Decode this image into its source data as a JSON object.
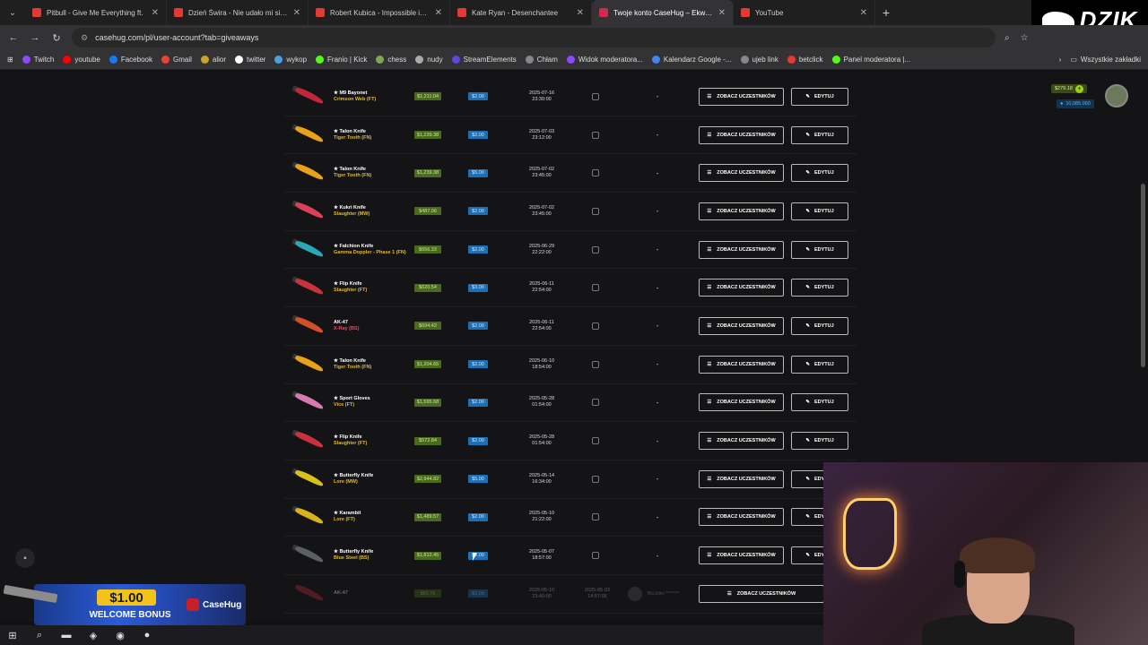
{
  "browser": {
    "tabs": [
      {
        "label": "Pitbull - Give Me Everything ft.",
        "active": false
      },
      {
        "label": "Dzień Świra - Nie udało mi się z",
        "active": false
      },
      {
        "label": "Robert Kubica - Impossible is n",
        "active": false
      },
      {
        "label": "Kate Ryan - Desenchantee",
        "active": false
      },
      {
        "label": "Twoje konto CaseHug – Ekwipu",
        "active": true
      },
      {
        "label": "YouTube",
        "active": false
      }
    ],
    "url": "casehug.com/pl/user-account?tab=giveaways",
    "bookmarks": [
      "Twitch",
      "youtube",
      "Facebook",
      "Gmail",
      "alior",
      "twitter",
      "wykop",
      "Franio | Kick",
      "chess",
      "nudy",
      "StreamElements",
      "Chłam",
      "Widok moderatora...",
      "Kalendarz Google -...",
      "ujeb link",
      "betclick",
      "Panel moderatora |..."
    ],
    "bookmarks_all": "Wszystkie zakładki"
  },
  "overlay": {
    "brand": "DZIK"
  },
  "user": {
    "balance": "$279.18",
    "coins": "10,085.060"
  },
  "buttons": {
    "view": "ZOBACZ UCZESTNIKÓW",
    "edit": "EDYTUJ"
  },
  "rows": [
    {
      "name": "★ M9 Bayonet",
      "cond": "Crimson Web (FT)",
      "price": "$1,211.04",
      "cost": "$2.00",
      "date": "2025-07-16",
      "time": "23:30:00",
      "blade": "#c0283a"
    },
    {
      "name": "★ Talon Knife",
      "cond": "Tiger Tooth (FN)",
      "price": "$1,239.38",
      "cost": "$2.00",
      "date": "2025-07-03",
      "time": "23:12:00",
      "blade": "#e8a21a"
    },
    {
      "name": "★ Talon Knife",
      "cond": "Tiger Tooth (FN)",
      "price": "$1,239.38",
      "cost": "$5.00",
      "date": "2025-07-02",
      "time": "23:45:00",
      "blade": "#e8a21a"
    },
    {
      "name": "★ Kukri Knife",
      "cond": "Slaughter (MW)",
      "price": "$487.06",
      "cost": "$2.00",
      "date": "2025-07-02",
      "time": "23:45:00",
      "blade": "#d94256"
    },
    {
      "name": "★ Falchion Knife",
      "cond": "Gamma Doppler - Phase 1 (FN)",
      "price": "$656.33",
      "cost": "$2.00",
      "date": "2025-06-29",
      "time": "22:22:00",
      "blade": "#2aa8b8"
    },
    {
      "name": "★ Flip Knife",
      "cond": "Slaughter (FT)",
      "price": "$620.54",
      "cost": "$3.00",
      "date": "2025-06-11",
      "time": "22:54:00",
      "blade": "#c8323c"
    },
    {
      "name": "AK-47",
      "cond": "X-Ray (BS)",
      "price": "$694.42",
      "cost": "$2.00",
      "date": "2025-06-11",
      "time": "22:54:00",
      "blade": "#d0502a"
    },
    {
      "name": "★ Talon Knife",
      "cond": "Tiger Tooth (FN)",
      "price": "$1,204.65",
      "cost": "$2.00",
      "date": "2025-06-10",
      "time": "18:54:00",
      "blade": "#e8a21a"
    },
    {
      "name": "★ Sport Gloves",
      "cond": "Vice (FT)",
      "price": "$1,595.68",
      "cost": "$2.00",
      "date": "2025-05-28",
      "time": "01:54:00",
      "blade": "#d77ab2"
    },
    {
      "name": "★ Flip Knife",
      "cond": "Slaughter (FT)",
      "price": "$572.84",
      "cost": "$2.00",
      "date": "2025-05-28",
      "time": "01:54:00",
      "blade": "#c8323c"
    },
    {
      "name": "★ Butterfly Knife",
      "cond": "Lore (MW)",
      "price": "$2,944.82",
      "cost": "$5.00",
      "date": "2025-05-14",
      "time": "16:34:00",
      "blade": "#d8c21a"
    },
    {
      "name": "★ Karambit",
      "cond": "Lore (FT)",
      "price": "$1,489.57",
      "cost": "$2.00",
      "date": "2025-05-10",
      "time": "21:22:00",
      "blade": "#d8b21a"
    },
    {
      "name": "★ Butterfly Knife",
      "cond": "Blue Steel (BS)",
      "price": "$1,812.45",
      "cost": "$2.00",
      "date": "2025-05-07",
      "time": "18:57:00",
      "blade": "#5a5f66"
    }
  ],
  "last_row": {
    "name": "AK-47",
    "price": "$62.76",
    "cost": "$3.00",
    "date": "2025-05-10",
    "time": "23:40:00",
    "date2": "2025-05-03",
    "time2": "14:57:06",
    "winner": "BloJobki ********",
    "button": "ZOBACZ UCZESTNIKÓW"
  },
  "bonus": {
    "amount": "$1.00",
    "text": "WELCOME BONUS",
    "logo": "CaseHug"
  }
}
